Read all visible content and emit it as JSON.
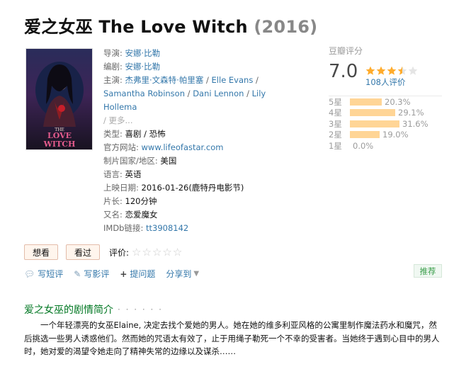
{
  "title": {
    "name": "爱之女巫 The Love Witch",
    "year": "(2016)"
  },
  "poster": {
    "alt_title_line1": "THE",
    "alt_title_line2": "LOVE",
    "alt_title_line3": "WITCH"
  },
  "info": {
    "director_label": "导演:",
    "director": "安娜·比勒",
    "writer_label": "编剧:",
    "writer": "安娜·比勒",
    "cast_label": "主演:",
    "cast": [
      "杰弗里·文森特·帕里塞",
      "Elle Evans",
      "Samantha Robinson",
      "Dani Lennon",
      "Lily Hollema"
    ],
    "cast_more": "更多...",
    "genre_label": "类型:",
    "genre": "喜剧 / 恐怖",
    "site_label": "官方网站:",
    "site": "www.lifeofastar.com",
    "country_label": "制片国家/地区:",
    "country": "美国",
    "language_label": "语言:",
    "language": "英语",
    "release_label": "上映日期:",
    "release": "2016-01-26(鹿特丹电影节)",
    "runtime_label": "片长:",
    "runtime": "120分钟",
    "aka_label": "又名:",
    "aka": "恋爱魔女",
    "imdb_label": "IMDb链接:",
    "imdb": "tt3908142"
  },
  "rating": {
    "header": "豆瓣评分",
    "score": "7.0",
    "stars": 3.5,
    "votes": "108人评价",
    "star_color": "#ffac2d",
    "bar_color": "#ffd596",
    "distribution": [
      {
        "level": "5星",
        "percent": "20.3%",
        "fraction": 0.203
      },
      {
        "level": "4星",
        "percent": "29.1%",
        "fraction": 0.291
      },
      {
        "level": "3星",
        "percent": "31.6%",
        "fraction": 0.316
      },
      {
        "level": "2星",
        "percent": "19.0%",
        "fraction": 0.19
      },
      {
        "level": "1星",
        "percent": "0.0%",
        "fraction": 0
      }
    ]
  },
  "actions": {
    "wish_label": "想看",
    "done_label": "看过",
    "rate_label": "评价:"
  },
  "links": {
    "short_review": "写短评",
    "review": "写影评",
    "question": "提问题",
    "share": "分享到"
  },
  "recommend": "推荐",
  "summary": {
    "heading": "爱之女巫的剧情简介",
    "dots": "· · · · · ·",
    "text": "一个年轻漂亮的女巫Elaine, 决定去找个爱她的男人。她在她的维多利亚风格的公寓里制作魔法药水和魔咒，然后挑选一些男人诱惑他们。然而她的咒语太有效了，止于用绳子勒死一个不幸的受害者。当她终于遇到心目中的男人时，她对爱的渴望令她走向了精神失常的边缘以及谋杀……"
  }
}
